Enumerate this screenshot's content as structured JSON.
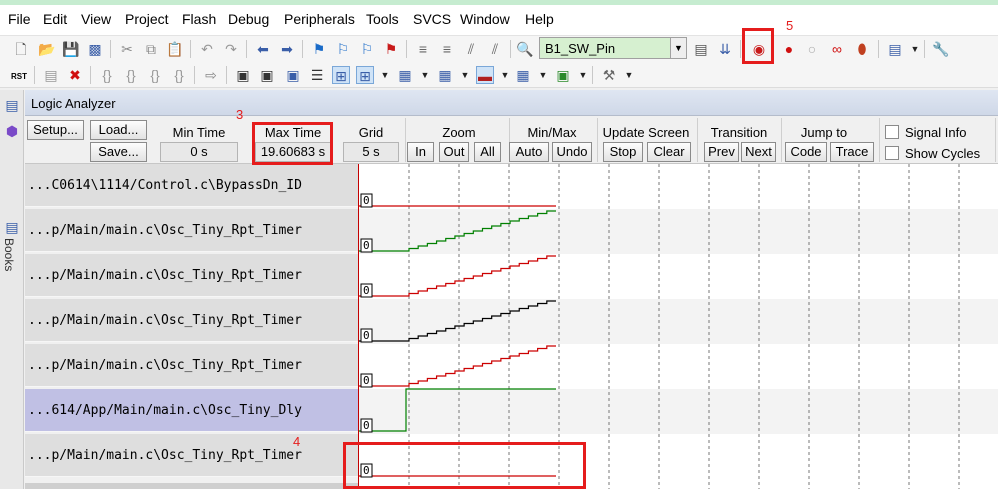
{
  "menu": [
    "File",
    "Edit",
    "View",
    "Project",
    "Flash",
    "Debug",
    "Peripherals",
    "Tools",
    "SVCS",
    "Window",
    "Help"
  ],
  "toolbar": {
    "target_name": "B1_SW_Pin",
    "rst_label": "RST"
  },
  "sidebar": {
    "books_label": "Books"
  },
  "logic_analyzer": {
    "title": "Logic Analyzer",
    "setup_button": "Setup...",
    "load_button": "Load...",
    "save_button": "Save...",
    "min_time_label": "Min Time",
    "min_time_value": "0 s",
    "max_time_label": "Max Time",
    "max_time_value": "19.60683 s",
    "grid_label": "Grid",
    "grid_value": "5 s",
    "zoom_label": "Zoom",
    "zoom_in": "In",
    "zoom_out": "Out",
    "zoom_all": "All",
    "minmax_label": "Min/Max",
    "minmax_auto": "Auto",
    "minmax_undo": "Undo",
    "update_label": "Update Screen",
    "update_stop": "Stop",
    "update_clear": "Clear",
    "transition_label": "Transition",
    "transition_prev": "Prev",
    "transition_next": "Next",
    "jump_label": "Jump to",
    "jump_code": "Code",
    "jump_trace": "Trace",
    "signal_info": "Signal Info",
    "show_cycles": "Show Cycles",
    "signals": [
      {
        "name": "...C0614\\1114/Control.c\\BypassDn_ID",
        "value": "0",
        "color": "#cc0000"
      },
      {
        "name": "...p/Main/main.c\\Osc_Tiny_Rpt_Timer",
        "value": "0",
        "color": "#008000"
      },
      {
        "name": "...p/Main/main.c\\Osc_Tiny_Rpt_Timer",
        "value": "0",
        "color": "#cc0000"
      },
      {
        "name": "...p/Main/main.c\\Osc_Tiny_Rpt_Timer",
        "value": "0",
        "color": "#000000"
      },
      {
        "name": "...p/Main/main.c\\Osc_Tiny_Rpt_Timer",
        "value": "0",
        "color": "#cc0000"
      },
      {
        "name": "...614/App/Main/main.c\\Osc_Tiny_Dly",
        "value": "0",
        "color": "#008000"
      },
      {
        "name": "...p/Main/main.c\\Osc_Tiny_Rpt_Timer",
        "value": "0",
        "color": "#cc0000"
      }
    ]
  },
  "annotations": {
    "label_3": "3",
    "label_4": "4",
    "label_5": "5",
    "color": "#e51c1c"
  }
}
